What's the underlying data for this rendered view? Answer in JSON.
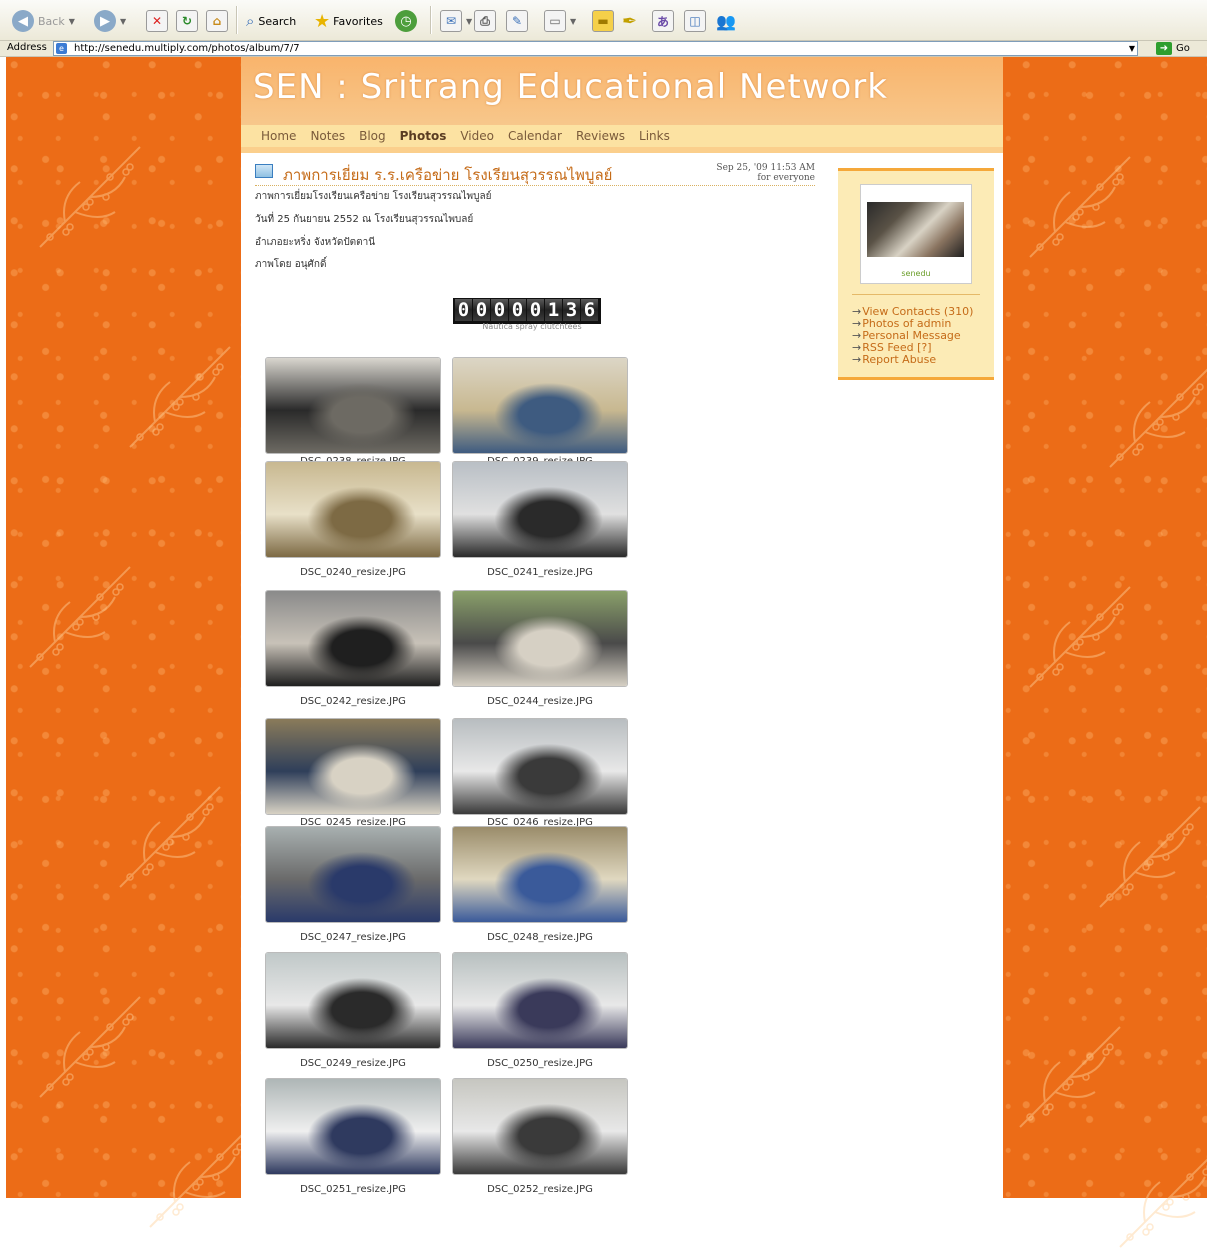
{
  "browser": {
    "back_label": "Back",
    "search_label": "Search",
    "favorites_label": "Favorites",
    "address_label": "Address",
    "url": "http://senedu.multiply.com/photos/album/7/7",
    "go_label": "Go"
  },
  "site": {
    "title": "SEN : Sritrang Educational Network",
    "nav": [
      "Home",
      "Notes",
      "Blog",
      "Photos",
      "Video",
      "Calendar",
      "Reviews",
      "Links"
    ],
    "active_nav": "Photos"
  },
  "post": {
    "title": "ภาพการเยี่ยม ร.ร.เครือข่าย โรงเรียนสุวรรณไพบูลย์",
    "date": "Sep 25, '09 11:53 AM",
    "visibility": "for everyone",
    "description": [
      "ภาพการเยี่ยมโรงเรียนเครือข่าย โรงเรียนสุวรรณไพบูลย์",
      "วันที่ 25 กันยายน 2552 ณ โรงเรียนสุวรรณไพบลย์",
      "อำเภอยะหริ่ง จังหวัดปัตตานี",
      "ภาพโดย อนุศักดิ์"
    ]
  },
  "counter": {
    "digits": [
      "0",
      "0",
      "0",
      "0",
      "0",
      "1",
      "3",
      "6"
    ],
    "caption": "Nautica spray clutchtees"
  },
  "photos": [
    {
      "caption": "DSC_0238_resize.JPG"
    },
    {
      "caption": "DSC_0239_resize.JPG"
    },
    {
      "caption": "DSC_0240_resize.JPG"
    },
    {
      "caption": "DSC_0241_resize.JPG"
    },
    {
      "caption": "DSC_0242_resize.JPG"
    },
    {
      "caption": "DSC_0244_resize.JPG"
    },
    {
      "caption": "DSC_0245_resize.JPG"
    },
    {
      "caption": "DSC_0246_resize.JPG"
    },
    {
      "caption": "DSC_0247_resize.JPG"
    },
    {
      "caption": "DSC_0248_resize.JPG"
    },
    {
      "caption": "DSC_0249_resize.JPG"
    },
    {
      "caption": "DSC_0250_resize.JPG"
    },
    {
      "caption": "DSC_0251_resize.JPG"
    },
    {
      "caption": "DSC_0252_resize.JPG"
    }
  ],
  "sidebar": {
    "profile_name": "senedu",
    "links": [
      "View Contacts (310)",
      "Photos of admin",
      "Personal Message",
      "RSS Feed [?]",
      "Report Abuse"
    ]
  },
  "colors": {
    "page_background": "#ec6c17",
    "header": "#f9b46c",
    "nav_bar": "#fce2a2",
    "link": "#c56b18",
    "sidebar_bg": "#fcebb6"
  }
}
